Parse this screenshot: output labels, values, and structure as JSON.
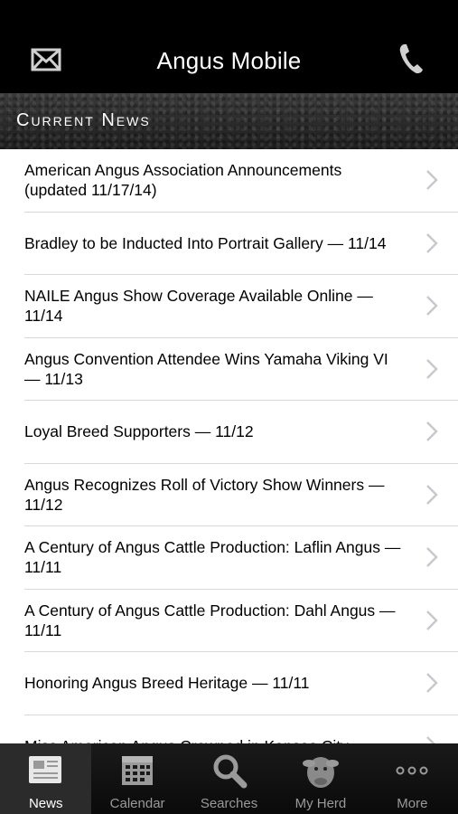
{
  "header": {
    "title": "Angus Mobile"
  },
  "banner": {
    "label": "Current News"
  },
  "news": [
    {
      "title": "American Angus Association Announcements (updated 11/17/14)"
    },
    {
      "title": "Bradley to be Inducted Into Portrait Gallery — 11/14"
    },
    {
      "title": "NAILE Angus Show Coverage Available Online — 11/14"
    },
    {
      "title": "Angus Convention Attendee Wins Yamaha Viking VI — 11/13"
    },
    {
      "title": "Loyal Breed Supporters — 11/12"
    },
    {
      "title": "Angus Recognizes Roll of Victory Show Winners — 11/12"
    },
    {
      "title": "A Century of Angus Cattle Production: Laflin Angus — 11/11"
    },
    {
      "title": "A Century of Angus Cattle Production: Dahl Angus — 11/11"
    },
    {
      "title": "Honoring Angus Breed Heritage — 11/11"
    },
    {
      "title": "Miss American Angus Crowned in Kansas City —"
    }
  ],
  "tabbar": {
    "tabs": [
      {
        "label": "News",
        "icon": "newspaper-icon",
        "active": true
      },
      {
        "label": "Calendar",
        "icon": "calendar-icon",
        "active": false
      },
      {
        "label": "Searches",
        "icon": "search-icon",
        "active": false
      },
      {
        "label": "My Herd",
        "icon": "angus-head-icon",
        "active": false
      },
      {
        "label": "More",
        "icon": "more-icon",
        "active": false
      }
    ]
  },
  "colors": {
    "header_bg": "#000000",
    "tabbar_bg": "#0a0a0a",
    "active_tab_bg": "#2b2b2b",
    "chevron": "#c7c7cc"
  }
}
